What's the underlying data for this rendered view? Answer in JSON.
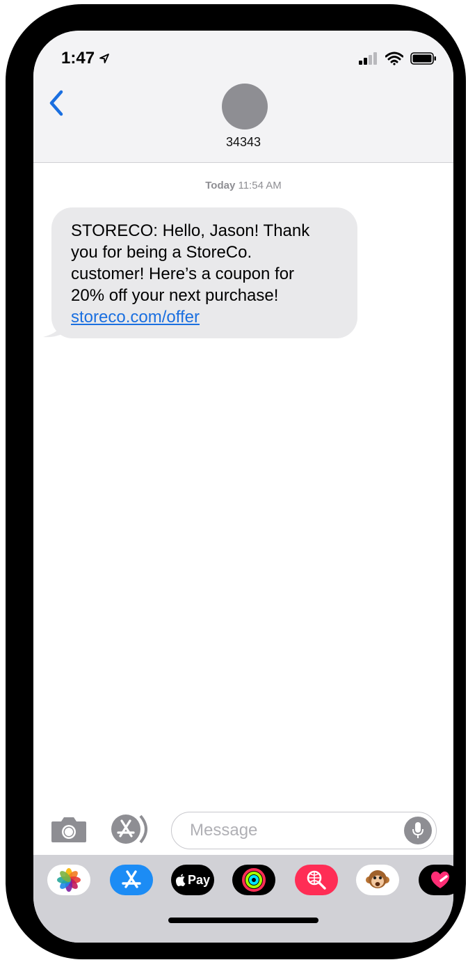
{
  "status": {
    "time": "1:47"
  },
  "contact": {
    "name": "34343"
  },
  "conversation": {
    "timestamp_day": "Today",
    "timestamp_time": "11:54 AM",
    "message": {
      "lines": [
        "STORECO: Hello, Jason! Thank",
        "you for being a StoreCo.",
        "customer! Here’s a coupon for",
        "20% off your next purchase!"
      ],
      "link": "storeco.com/offer"
    }
  },
  "composer": {
    "placeholder": "Message",
    "value": ""
  },
  "apps": {
    "pay_label": "Pay"
  },
  "colors": {
    "accent": "#1a6fe0",
    "bubble": "#e9e9eb",
    "drawer": "#d1d1d6",
    "activity_ring": "#a6ff00",
    "search_pink": "#ff2d55"
  }
}
